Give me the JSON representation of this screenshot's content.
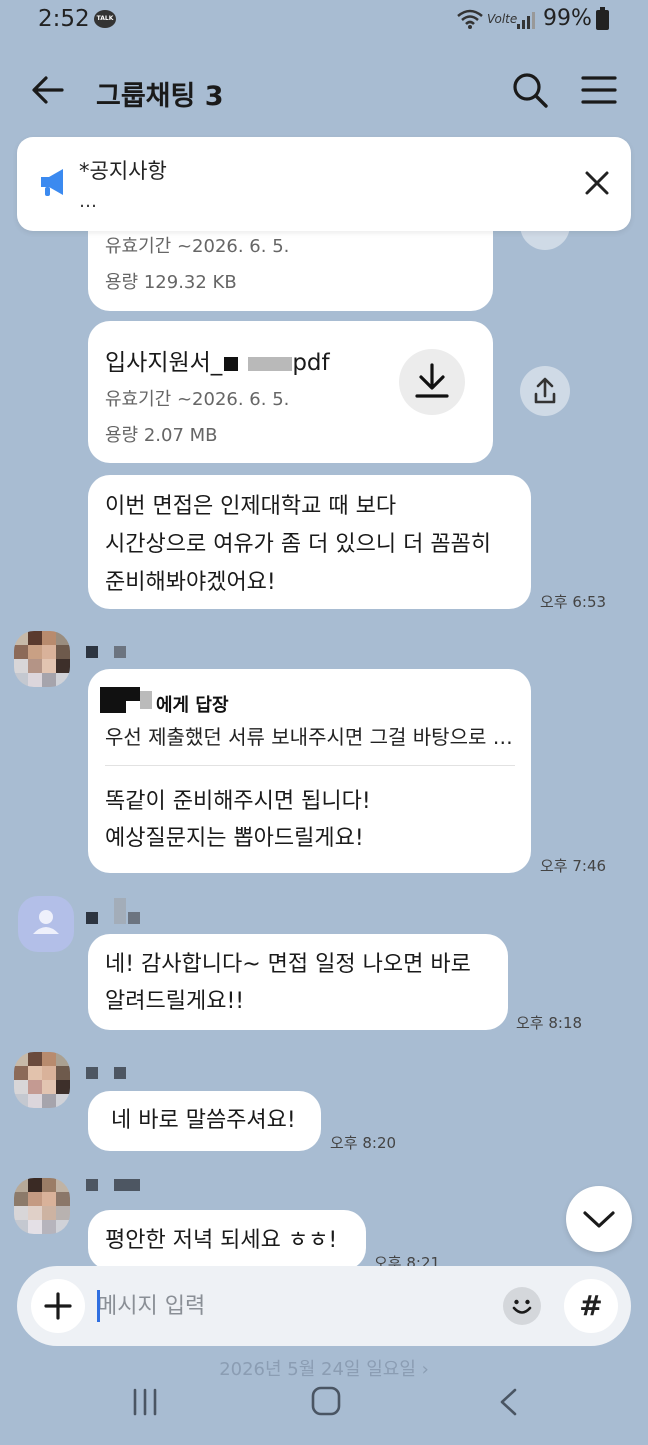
{
  "status_bar": {
    "time": "2:52",
    "talk_badge": "TALK",
    "network": "Volte",
    "battery": "99%"
  },
  "header": {
    "title": "그룹채팅 3"
  },
  "notice": {
    "title": "*공지사항",
    "preview": "…"
  },
  "messages": {
    "file1": {
      "expiry": "유효기간 ~2026. 6. 5.",
      "size": "용량  129.32 KB"
    },
    "file2": {
      "name": "입사지원서_",
      "ext": "pdf",
      "expiry": "유효기간 ~2026. 6. 5.",
      "size": "용량  2.07 MB"
    },
    "msg1": {
      "lines": [
        "이번 면접은 인제대학교 때 보다",
        "시간상으로 여유가 좀 더 있으니 더 꼼꼼히",
        "준비해봐야겠어요!"
      ],
      "time": "오후 6:53"
    },
    "msg2": {
      "reply_to": "에게 답장",
      "quote": "우선 제출했던 서류 보내주시면 그걸 바탕으로 …",
      "lines": [
        "똑같이 준비해주시면 됩니다!",
        "예상질문지는 뽑아드릴게요!"
      ],
      "time": "오후 7:46"
    },
    "msg3": {
      "lines": [
        "네! 감사합니다~ 면접 일정 나오면 바로",
        "알려드릴게요!!"
      ],
      "time": "오후 8:18"
    },
    "msg4": {
      "text": "네 바로 말씀주셔요!",
      "time": "오후 8:20"
    },
    "msg5": {
      "text": "평안한 저녁 되세요 ㅎㅎ!",
      "time": "오후 8:21"
    }
  },
  "input": {
    "placeholder": "메시지 입력",
    "hashtag": "#"
  },
  "date_divider": "2026년 5월 24일 일요일  ›",
  "colors": {
    "background": "#a8bcd2",
    "bubble": "#ffffff",
    "accent": "#2f6fe0",
    "megaphone": "#3b8af0"
  }
}
